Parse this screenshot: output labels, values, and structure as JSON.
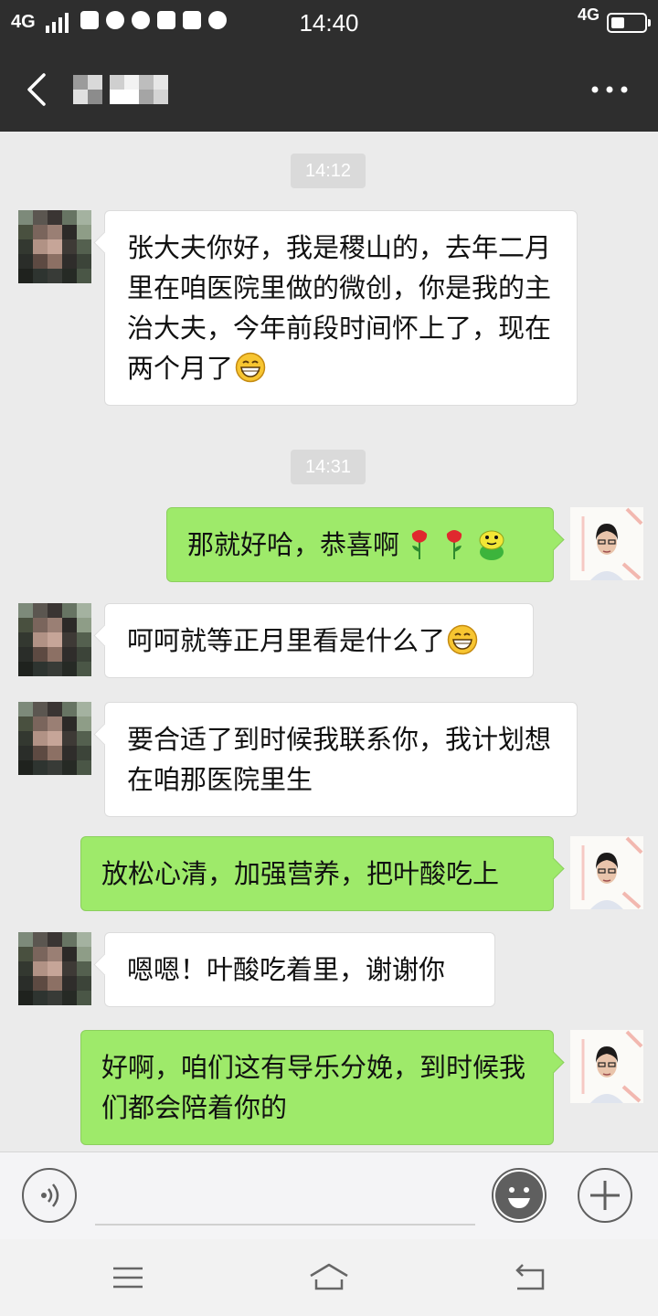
{
  "status_bar": {
    "network_left": "4G",
    "time": "14:40",
    "network_right": "4G",
    "icons": [
      "signal-icon",
      "android-icon",
      "planet-icon",
      "cloud-icon",
      "sogou-icon",
      "shopping-bag-icon",
      "crown-icon",
      "battery-icon"
    ]
  },
  "header": {
    "back_icon": "chevron-left-icon",
    "title": "",
    "title_pixelated": true,
    "more_icon": "more-dots-icon"
  },
  "messages": [
    {
      "type": "timestamp",
      "text": "14:12"
    },
    {
      "type": "incoming",
      "text": "张大夫你好，我是稷山的，去年二月里在咱医院里做的微创，你是我的主治大夫，今年前段时间怀上了，现在两个月了",
      "emoji": "grinning-face-emoji"
    },
    {
      "type": "timestamp",
      "text": "14:31"
    },
    {
      "type": "outgoing",
      "text": "那就好哈，恭喜啊",
      "emoji": [
        "rose-emoji",
        "rose-emoji",
        "frog-emoji"
      ]
    },
    {
      "type": "incoming",
      "text": "呵呵就等正月里看是什么了",
      "emoji": "grinning-face-emoji"
    },
    {
      "type": "incoming",
      "text": "要合适了到时候我联系你，我计划想在咱那医院里生"
    },
    {
      "type": "outgoing",
      "text": "放松心清，加强营养，把叶酸吃上"
    },
    {
      "type": "incoming",
      "text": "嗯嗯！叶酸吃着里，谢谢你"
    },
    {
      "type": "outgoing",
      "text": "好啊，咱们这有导乐分娩，到时候我们都会陪着你的"
    }
  ],
  "input_bar": {
    "voice_icon": "voice-icon",
    "emoji_icon": "smiley-icon",
    "plus_icon": "plus-icon"
  },
  "system_nav": {
    "menu_icon": "menu-icon",
    "home_icon": "home-icon",
    "back_icon": "return-icon"
  },
  "colors": {
    "header_bg": "#2e2e2e",
    "chat_bg": "#ebebeb",
    "incoming_bubble": "#ffffff",
    "outgoing_bubble": "#9eea6a",
    "timestamp_bg": "#dadada"
  }
}
